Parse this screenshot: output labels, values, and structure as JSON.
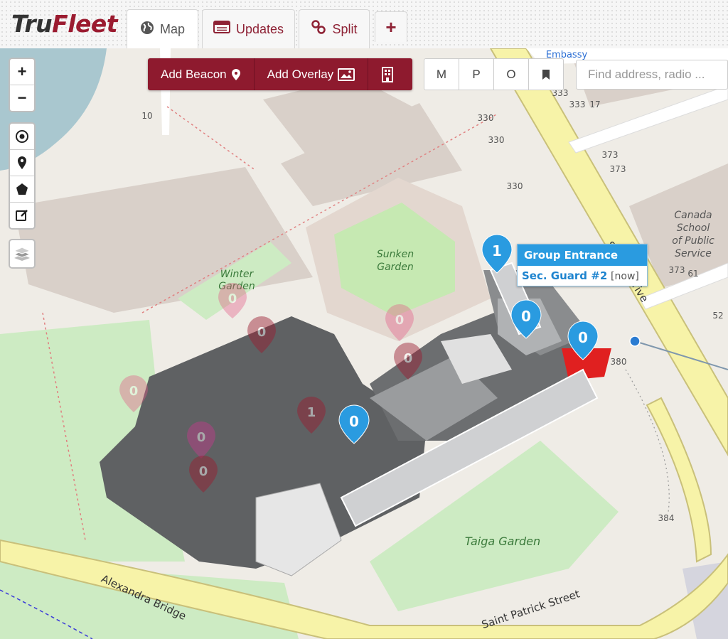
{
  "app": {
    "logo_prefix": "Tru",
    "logo_suffix": "Fleet"
  },
  "tabs": [
    {
      "label": "Map",
      "icon": "globe-icon"
    },
    {
      "label": "Updates",
      "icon": "calendar-icon"
    },
    {
      "label": "Split",
      "icon": "link-icon"
    },
    {
      "label": "+",
      "icon": "plus-icon"
    }
  ],
  "zoom": {
    "in": "+",
    "out": "−"
  },
  "toolbar": {
    "add_beacon": "Add Beacon",
    "add_overlay": "Add Overlay"
  },
  "view_toggles": [
    "M",
    "P",
    "O"
  ],
  "search": {
    "placeholder": "Find address, radio ..."
  },
  "popup": {
    "title": "Group Entrance",
    "name": "Sec. Guard #2",
    "status": "[now]"
  },
  "map_labels": {
    "sunken_garden_1": "Sunken",
    "sunken_garden_2": "Garden",
    "winter_garden_1": "Winter",
    "winter_garden_2": "Garden",
    "taiga_garden": "Taiga Garden",
    "alexandra_bridge": "Alexandra Bridge",
    "saint_patrick": "Saint Patrick Street",
    "embassy": "Embassy",
    "school_1": "Canada",
    "school_2": "School",
    "school_3": "of Public",
    "school_4": "Service",
    "sussex_drive": "Sussex Drive",
    "num_10": "10",
    "num_330a": "330",
    "num_330b": "330",
    "num_330c": "330",
    "num_333a": "333",
    "num_333b": "333",
    "num_17": "17",
    "num_373a": "373",
    "num_373b": "373",
    "num_373c": "373",
    "num_61": "61",
    "num_52": "52",
    "num_380": "380",
    "num_384": "384"
  },
  "markers": {
    "active": [
      "1",
      "0",
      "0",
      "0"
    ],
    "faded": [
      "0",
      "0",
      "0",
      "0",
      "0",
      "1",
      "0",
      "0"
    ]
  },
  "colors": {
    "brand": "#8e1a2e",
    "marker": "#2a9be0",
    "popup_header": "#2a9be0"
  }
}
